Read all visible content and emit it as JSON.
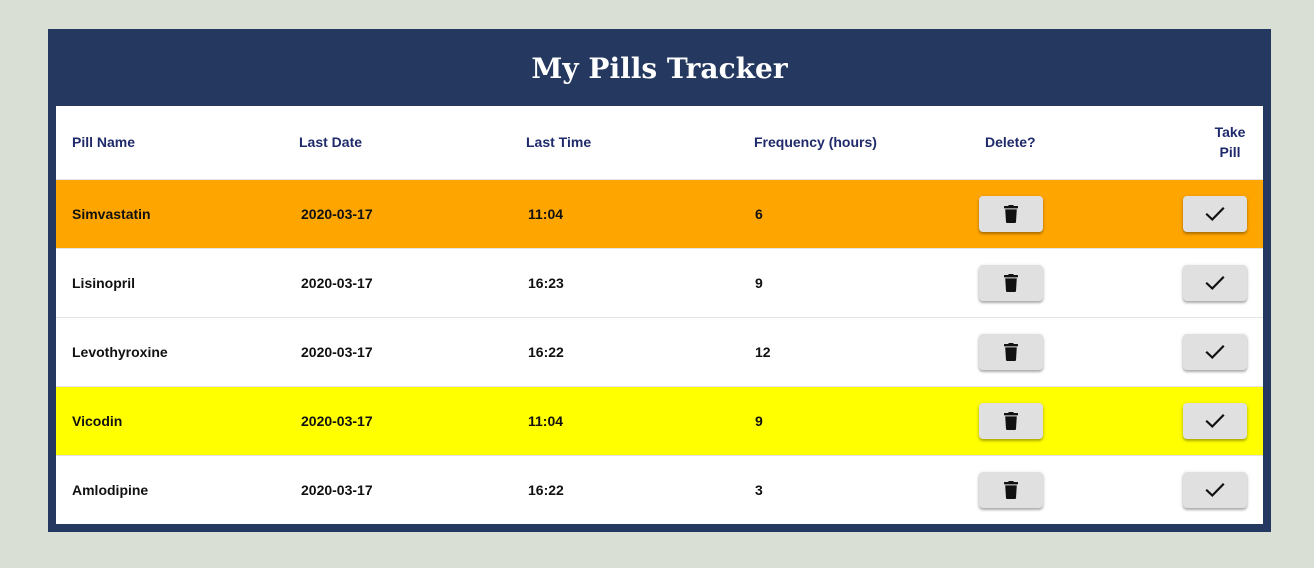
{
  "app": {
    "title": "My Pills Tracker"
  },
  "colors": {
    "page_background": "#d9dfd5",
    "frame": "#243860",
    "header_text": "#1f2a6b",
    "highlight_orange": "#ffa500",
    "highlight_yellow": "#ffff00",
    "button": "#e0e0e0"
  },
  "table": {
    "headers": {
      "pill_name": "Pill Name",
      "last_date": "Last Date",
      "last_time": "Last Time",
      "frequency": "Frequency (hours)",
      "delete": "Delete?",
      "take_line1": "Take",
      "take_line2": "Pill"
    },
    "rows": [
      {
        "name": "Simvastatin",
        "date": "2020-03-17",
        "time": "11:04",
        "frequency": "6",
        "highlight": "#ffa500"
      },
      {
        "name": "Lisinopril",
        "date": "2020-03-17",
        "time": "16:23",
        "frequency": "9",
        "highlight": "#ffffff"
      },
      {
        "name": "Levothyroxine",
        "date": "2020-03-17",
        "time": "16:22",
        "frequency": "12",
        "highlight": "#ffffff"
      },
      {
        "name": "Vicodin",
        "date": "2020-03-17",
        "time": "11:04",
        "frequency": "9",
        "highlight": "#ffff00"
      },
      {
        "name": "Amlodipine",
        "date": "2020-03-17",
        "time": "16:22",
        "frequency": "3",
        "highlight": "#ffffff"
      }
    ],
    "icons": {
      "delete": "trash-icon",
      "take": "checkmark-icon"
    }
  }
}
